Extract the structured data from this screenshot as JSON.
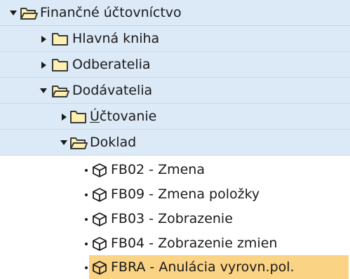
{
  "tree": {
    "root": {
      "label": "Finančné účtovníctvo",
      "children": {
        "hlavna": {
          "label": "Hlavná kniha"
        },
        "odberatelia": {
          "label": "Odberatelia"
        },
        "dodavatelia": {
          "label": "Dodávatelia",
          "children": {
            "uctovanie": {
              "label_first": "Ú",
              "label_rest": "čtovanie"
            },
            "doklad": {
              "label": "Doklad",
              "transactions": [
                {
                  "label": "FB02 - Zmena"
                },
                {
                  "label": "FB09 - Zmena položky"
                },
                {
                  "label": "FB03 - Zobrazenie"
                },
                {
                  "label": "FB04 - Zobrazenie zmien"
                },
                {
                  "label": "FBRA - Anulácia vyrovn.pol."
                }
              ]
            }
          }
        }
      }
    }
  },
  "colors": {
    "folder_row_bg": "#dce9f6",
    "selection_bg": "#fbd384",
    "folder_icon_fill": "#fdf0b0",
    "folder_icon_stroke": "#3a3a3a"
  },
  "icons": {
    "folder_open": "folder-open-icon",
    "folder_closed": "folder-closed-icon",
    "transaction": "transaction-cube-icon",
    "expanded": "chevron-down-icon",
    "collapsed": "chevron-right-icon"
  },
  "selected_item": "FBRA - Anulácia vyrovn.pol."
}
